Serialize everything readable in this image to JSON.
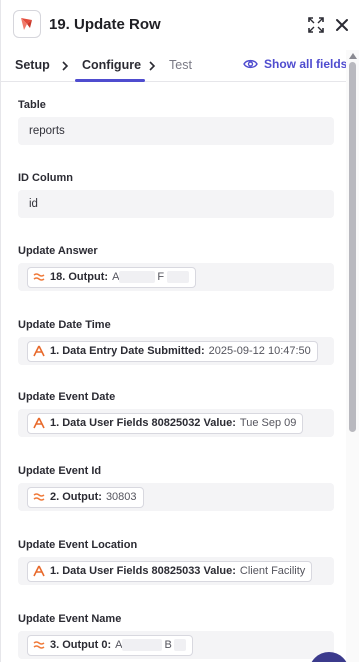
{
  "header": {
    "title": "19. Update Row"
  },
  "tabs": [
    {
      "label": "Setup"
    },
    {
      "label": "Configure"
    },
    {
      "label": "Test"
    }
  ],
  "show_all_label": "Show all fields",
  "fields": [
    {
      "label": "Table",
      "value": "reports"
    },
    {
      "label": "ID Column",
      "value": "id"
    },
    {
      "label": "Update Answer",
      "pill_key": "18. Output:",
      "pill_value": "A",
      "pill_value_tail": "F",
      "pill_icon": "formatter-icon"
    },
    {
      "label": "Update Date Time",
      "pill_key": "1. Data Entry Date Submitted:",
      "pill_value": "2025-09-12 10:47:50",
      "pill_icon": "trigger-app-icon"
    },
    {
      "label": "Update Event Date",
      "pill_key": "1. Data User Fields 80825032 Value:",
      "pill_value": "Tue Sep 09",
      "pill_icon": "trigger-app-icon"
    },
    {
      "label": "Update Event Id",
      "pill_key": "2. Output:",
      "pill_value": "30803",
      "pill_icon": "formatter-icon"
    },
    {
      "label": "Update Event Location",
      "pill_key": "1. Data User Fields 80825033 Value:",
      "pill_value": "Client Facility",
      "pill_icon": "trigger-app-icon"
    },
    {
      "label": "Update Event Name",
      "pill_key": "3. Output 0:",
      "pill_value": "A",
      "pill_value_tail": "B",
      "pill_icon": "formatter-icon"
    }
  ],
  "colors": {
    "accent": "#4f4ccf",
    "formatter_icon": "#f07a3a",
    "trigger_icon": "#e86a2c"
  }
}
